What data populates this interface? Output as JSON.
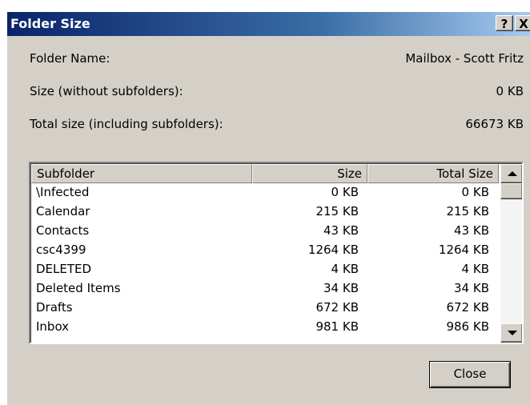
{
  "window": {
    "title": "Folder Size",
    "help_label": "?",
    "close_label": "X"
  },
  "fields": {
    "folder_name_label": "Folder Name:",
    "folder_name_value": "Mailbox - Scott Fritz",
    "size_label": "Size (without subfolders):",
    "size_value": "0 KB",
    "total_label": "Total size (including subfolders):",
    "total_value": "66673 KB"
  },
  "table": {
    "columns": [
      "Subfolder",
      "Size",
      "Total Size"
    ],
    "rows": [
      {
        "name": "\\Infected",
        "size": "0 KB",
        "total": "0 KB"
      },
      {
        "name": "Calendar",
        "size": "215 KB",
        "total": "215 KB"
      },
      {
        "name": "Contacts",
        "size": "43 KB",
        "total": "43 KB"
      },
      {
        "name": "csc4399",
        "size": "1264 KB",
        "total": "1264 KB"
      },
      {
        "name": "DELETED",
        "size": "4 KB",
        "total": "4 KB"
      },
      {
        "name": "Deleted Items",
        "size": "34 KB",
        "total": "34 KB"
      },
      {
        "name": "Drafts",
        "size": "672 KB",
        "total": "672 KB"
      },
      {
        "name": "Inbox",
        "size": "981 KB",
        "total": "986 KB"
      }
    ]
  },
  "buttons": {
    "close": "Close"
  }
}
